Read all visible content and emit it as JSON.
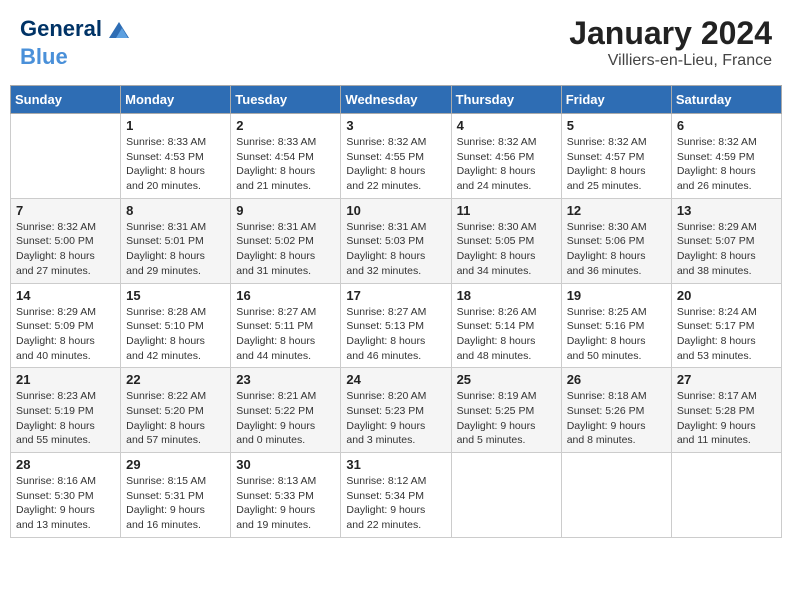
{
  "header": {
    "logo_line1": "General",
    "logo_line2": "Blue",
    "title": "January 2024",
    "subtitle": "Villiers-en-Lieu, France"
  },
  "calendar": {
    "days_of_week": [
      "Sunday",
      "Monday",
      "Tuesday",
      "Wednesday",
      "Thursday",
      "Friday",
      "Saturday"
    ],
    "weeks": [
      [
        {
          "day": "",
          "info": ""
        },
        {
          "day": "1",
          "info": "Sunrise: 8:33 AM\nSunset: 4:53 PM\nDaylight: 8 hours\nand 20 minutes."
        },
        {
          "day": "2",
          "info": "Sunrise: 8:33 AM\nSunset: 4:54 PM\nDaylight: 8 hours\nand 21 minutes."
        },
        {
          "day": "3",
          "info": "Sunrise: 8:32 AM\nSunset: 4:55 PM\nDaylight: 8 hours\nand 22 minutes."
        },
        {
          "day": "4",
          "info": "Sunrise: 8:32 AM\nSunset: 4:56 PM\nDaylight: 8 hours\nand 24 minutes."
        },
        {
          "day": "5",
          "info": "Sunrise: 8:32 AM\nSunset: 4:57 PM\nDaylight: 8 hours\nand 25 minutes."
        },
        {
          "day": "6",
          "info": "Sunrise: 8:32 AM\nSunset: 4:59 PM\nDaylight: 8 hours\nand 26 minutes."
        }
      ],
      [
        {
          "day": "7",
          "info": "Sunrise: 8:32 AM\nSunset: 5:00 PM\nDaylight: 8 hours\nand 27 minutes."
        },
        {
          "day": "8",
          "info": "Sunrise: 8:31 AM\nSunset: 5:01 PM\nDaylight: 8 hours\nand 29 minutes."
        },
        {
          "day": "9",
          "info": "Sunrise: 8:31 AM\nSunset: 5:02 PM\nDaylight: 8 hours\nand 31 minutes."
        },
        {
          "day": "10",
          "info": "Sunrise: 8:31 AM\nSunset: 5:03 PM\nDaylight: 8 hours\nand 32 minutes."
        },
        {
          "day": "11",
          "info": "Sunrise: 8:30 AM\nSunset: 5:05 PM\nDaylight: 8 hours\nand 34 minutes."
        },
        {
          "day": "12",
          "info": "Sunrise: 8:30 AM\nSunset: 5:06 PM\nDaylight: 8 hours\nand 36 minutes."
        },
        {
          "day": "13",
          "info": "Sunrise: 8:29 AM\nSunset: 5:07 PM\nDaylight: 8 hours\nand 38 minutes."
        }
      ],
      [
        {
          "day": "14",
          "info": "Sunrise: 8:29 AM\nSunset: 5:09 PM\nDaylight: 8 hours\nand 40 minutes."
        },
        {
          "day": "15",
          "info": "Sunrise: 8:28 AM\nSunset: 5:10 PM\nDaylight: 8 hours\nand 42 minutes."
        },
        {
          "day": "16",
          "info": "Sunrise: 8:27 AM\nSunset: 5:11 PM\nDaylight: 8 hours\nand 44 minutes."
        },
        {
          "day": "17",
          "info": "Sunrise: 8:27 AM\nSunset: 5:13 PM\nDaylight: 8 hours\nand 46 minutes."
        },
        {
          "day": "18",
          "info": "Sunrise: 8:26 AM\nSunset: 5:14 PM\nDaylight: 8 hours\nand 48 minutes."
        },
        {
          "day": "19",
          "info": "Sunrise: 8:25 AM\nSunset: 5:16 PM\nDaylight: 8 hours\nand 50 minutes."
        },
        {
          "day": "20",
          "info": "Sunrise: 8:24 AM\nSunset: 5:17 PM\nDaylight: 8 hours\nand 53 minutes."
        }
      ],
      [
        {
          "day": "21",
          "info": "Sunrise: 8:23 AM\nSunset: 5:19 PM\nDaylight: 8 hours\nand 55 minutes."
        },
        {
          "day": "22",
          "info": "Sunrise: 8:22 AM\nSunset: 5:20 PM\nDaylight: 8 hours\nand 57 minutes."
        },
        {
          "day": "23",
          "info": "Sunrise: 8:21 AM\nSunset: 5:22 PM\nDaylight: 9 hours\nand 0 minutes."
        },
        {
          "day": "24",
          "info": "Sunrise: 8:20 AM\nSunset: 5:23 PM\nDaylight: 9 hours\nand 3 minutes."
        },
        {
          "day": "25",
          "info": "Sunrise: 8:19 AM\nSunset: 5:25 PM\nDaylight: 9 hours\nand 5 minutes."
        },
        {
          "day": "26",
          "info": "Sunrise: 8:18 AM\nSunset: 5:26 PM\nDaylight: 9 hours\nand 8 minutes."
        },
        {
          "day": "27",
          "info": "Sunrise: 8:17 AM\nSunset: 5:28 PM\nDaylight: 9 hours\nand 11 minutes."
        }
      ],
      [
        {
          "day": "28",
          "info": "Sunrise: 8:16 AM\nSunset: 5:30 PM\nDaylight: 9 hours\nand 13 minutes."
        },
        {
          "day": "29",
          "info": "Sunrise: 8:15 AM\nSunset: 5:31 PM\nDaylight: 9 hours\nand 16 minutes."
        },
        {
          "day": "30",
          "info": "Sunrise: 8:13 AM\nSunset: 5:33 PM\nDaylight: 9 hours\nand 19 minutes."
        },
        {
          "day": "31",
          "info": "Sunrise: 8:12 AM\nSunset: 5:34 PM\nDaylight: 9 hours\nand 22 minutes."
        },
        {
          "day": "",
          "info": ""
        },
        {
          "day": "",
          "info": ""
        },
        {
          "day": "",
          "info": ""
        }
      ]
    ]
  }
}
